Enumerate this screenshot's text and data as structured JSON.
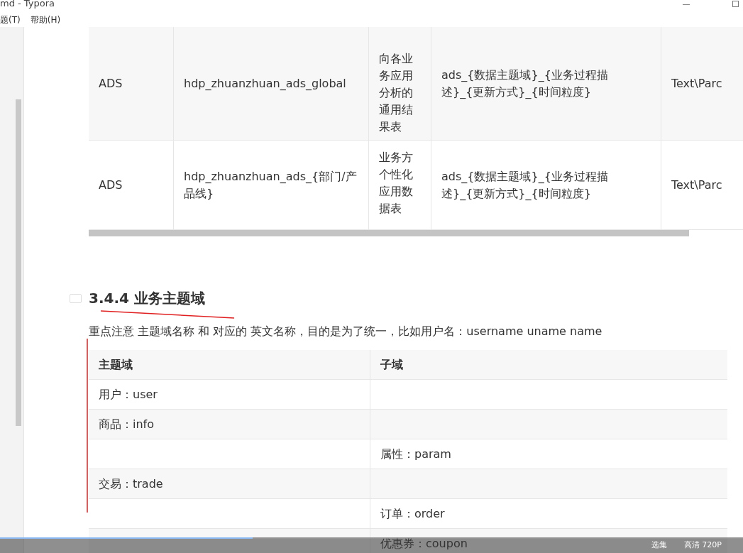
{
  "window": {
    "title": "md - Typora"
  },
  "menu": [
    "题(T)",
    "帮助(H)"
  ],
  "table_1": {
    "rows": [
      {
        "cells": [
          "ADS",
          "hdp_zhuanzhuan_ads_global",
          "向各业务应用分析的通用结果表",
          "ads_{数据主题域}_{业务过程描述}_{更新方式}_{时间粒度}",
          "Text\\Parc"
        ]
      },
      {
        "cells": [
          "ADS",
          "hdp_zhuanzhuan_ads_{部门/产品线}",
          "业务方个性化应用数据表",
          "ads_{数据主题域}_{业务过程描述}_{更新方式}_{时间粒度}",
          "Text\\Parc"
        ]
      }
    ]
  },
  "heading": "3.4.4 业务主题域",
  "paragraph": "重点注意 主题域名称 和 对应的 英文名称，目的是为了统一，比如用户名：username uname name",
  "table_2": {
    "columns": [
      "主题域",
      "子域"
    ],
    "rows": [
      {
        "column_1": "用户：user"
      },
      {
        "column_1": "商品：info"
      },
      {
        "column_2": "属性：param"
      },
      {
        "column_1": "交易：trade"
      },
      {
        "column_2": "订单：order"
      },
      {
        "column_2": "优惠券：coupon"
      }
    ]
  },
  "player": {
    "progress": {
      "level": 0.34
    },
    "labels": [
      "选集",
      "高清 720P"
    ]
  }
}
